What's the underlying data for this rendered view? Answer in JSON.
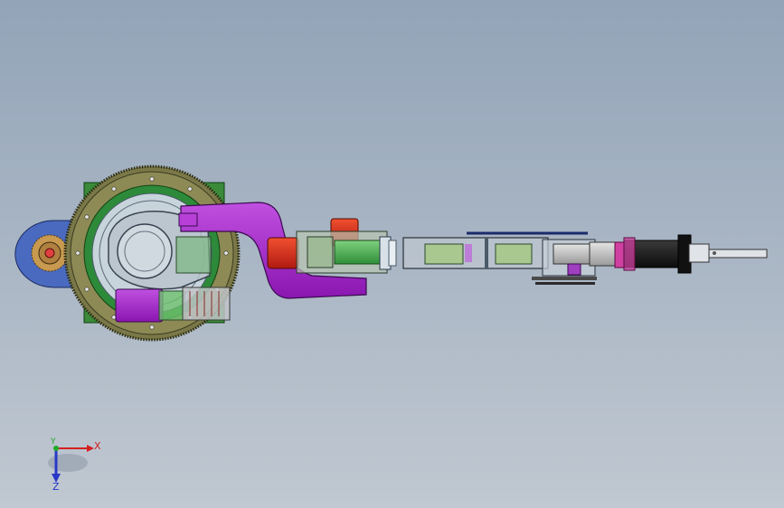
{
  "triad": {
    "x_label": "X",
    "y_label": "Y",
    "z_label": "Z",
    "x_color": "#d42020",
    "y_color": "#1faa2a",
    "z_color": "#2a38c8"
  },
  "colors": {
    "background_top": "#92a4b8",
    "background_bottom": "#c0c8d1",
    "base_green": "#3a8a3a",
    "gear_ring": "#8e8a55",
    "arm_purple": "#a020c8",
    "motor_red": "#e0301a",
    "gripper_black": "#1a1a1a"
  }
}
